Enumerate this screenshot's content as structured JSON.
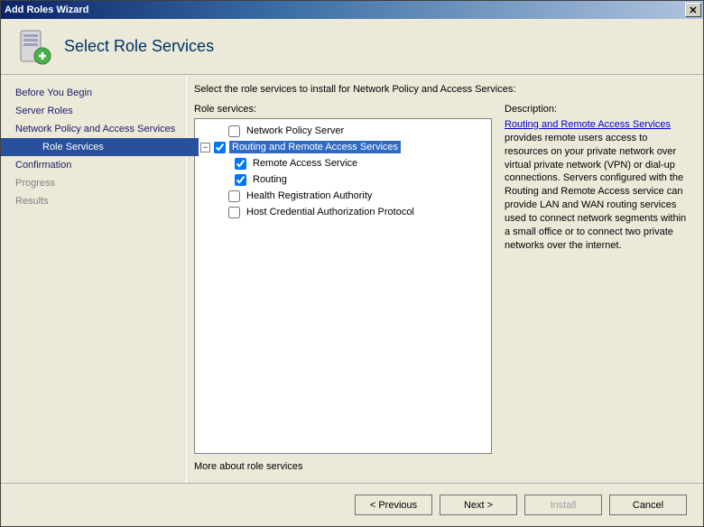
{
  "window": {
    "title": "Add Roles Wizard"
  },
  "header": {
    "title": "Select Role Services"
  },
  "sidebar": {
    "steps": [
      {
        "label": "Before You Begin"
      },
      {
        "label": "Server Roles"
      },
      {
        "label": "Network Policy and Access Services"
      },
      {
        "label": "Role Services"
      },
      {
        "label": "Confirmation"
      },
      {
        "label": "Progress"
      },
      {
        "label": "Results"
      }
    ]
  },
  "content": {
    "instruction": "Select the role services to install for Network Policy and Access Services:",
    "list_label": "Role services:",
    "tree": {
      "items": {
        "nps": "Network Policy Server",
        "rras": "Routing and Remote Access Services",
        "ras": "Remote Access Service",
        "routing": "Routing",
        "hra": "Health Registration Authority",
        "hcap": "Host Credential Authorization Protocol"
      }
    },
    "description": {
      "label": "Description:",
      "link": "Routing and Remote Access Services",
      "text": " provides remote users access to resources on your private network over virtual private network (VPN) or dial-up connections. Servers configured with the Routing and Remote Access service can provide LAN and WAN routing services used to connect network segments within a small office or to connect two private networks over the internet."
    },
    "more_link": "More about role services"
  },
  "footer": {
    "previous": "< Previous",
    "next": "Next >",
    "install": "Install",
    "cancel": "Cancel"
  }
}
